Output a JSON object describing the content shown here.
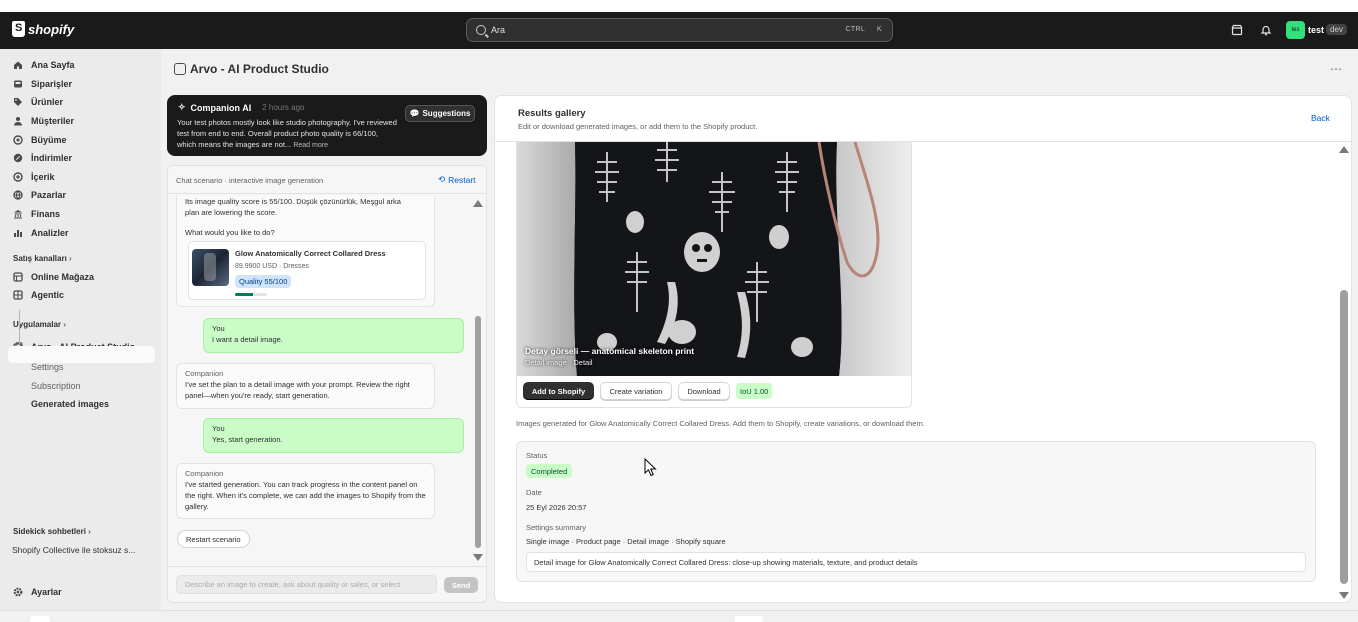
{
  "topbar": {
    "logo_text": "shopify",
    "search_placeholder": "Ara",
    "shortcut_ctrl": "CTRL",
    "shortcut_key": "K",
    "avatar_initials": "tes",
    "store_name": "test",
    "dev_badge": "dev",
    "accent_color": "#34e07a"
  },
  "sidebar": {
    "items": [
      {
        "label": "Ana Sayfa",
        "icon": "home-icon"
      },
      {
        "label": "Siparişler",
        "icon": "inbox-icon"
      },
      {
        "label": "Ürünler",
        "icon": "tag-icon"
      },
      {
        "label": "Müşteriler",
        "icon": "person-icon"
      },
      {
        "label": "Büyüme",
        "icon": "target-icon"
      },
      {
        "label": "İndirimler",
        "icon": "discount-icon"
      },
      {
        "label": "İçerik",
        "icon": "content-icon"
      },
      {
        "label": "Pazarlar",
        "icon": "globe-icon"
      },
      {
        "label": "Finans",
        "icon": "bank-icon"
      },
      {
        "label": "Analizler",
        "icon": "chart-icon"
      }
    ],
    "sales_channels_label": "Satış kanalları",
    "channels": [
      {
        "label": "Online Mağaza",
        "icon": "store-icon"
      },
      {
        "label": "Agentic",
        "icon": "grid-icon"
      }
    ],
    "apps_label": "Uygulamalar",
    "app_name": "Arvo - AI Product Studio",
    "app_subitems": [
      "Settings",
      "Subscription",
      "Generated images"
    ],
    "sidekick_label": "Sidekick sohbetleri",
    "sidekick_item": "Shopify Collective ile stoksuz s...",
    "settings_label": "Ayarlar"
  },
  "page": {
    "title": "Arvo - AI Product Studio",
    "more": "⋯"
  },
  "companion": {
    "title": "Companion AI",
    "time": "2 hours ago",
    "text": "Your test photos mostly look like studio photography. I've reviewed test from end to end. Overall product photo quality is 66/100, which means the images are not...",
    "read_more": "Read more",
    "suggestions": "Suggestions"
  },
  "chat": {
    "scenario_label": "Chat scenario · interactive image generation",
    "restart": "Restart",
    "first_bubble_line1": "Its image quality score is 55/100. Düşük çözünürlük, Meşgul arka",
    "first_bubble_line2": "plan are lowering the score.",
    "first_bubble_question": "What would you like to do?",
    "product": {
      "name": "Glow Anatomically Correct Collared Dress",
      "meta": "89.9900 USD · Dresses",
      "quality": "Quality 55/100",
      "quality_fraction": 0.55
    },
    "messages": [
      {
        "who": "You",
        "text": "I want a detail image."
      },
      {
        "who": "Companion",
        "text": "I've set the plan to a detail image with your prompt. Review the right panel—when you're ready, start generation."
      },
      {
        "who": "You",
        "text": "Yes, start generation."
      },
      {
        "who": "Companion",
        "text": "I've started generation. You can track progress in the content panel on the right. When it's complete, we can add the images to Shopify from the gallery."
      }
    ],
    "restart_scenario": "Restart scenario",
    "input_placeholder": "Describe an image to create, ask about quality or sales, or select",
    "send": "Send"
  },
  "results": {
    "title": "Results gallery",
    "subtitle": "Edit or download generated images, or add them to the Shopify product.",
    "back": "Back",
    "image_label": "Detay görseli — anatomical skeleton print",
    "image_sublabel": "Detail image · Detail",
    "add_to_shopify": "Add to Shopify",
    "create_variation": "Create variation",
    "download": "Download",
    "iou": "IoU 1.00",
    "note": "Images generated for Glow Anatomically Correct Collared Dress. Add them to Shopify, create variations, or download them.",
    "status_label": "Status",
    "status_value": "Completed",
    "date_label": "Date",
    "date_value": "25 Eyl 2026 20:57",
    "settings_label": "Settings summary",
    "settings_value": "Single image · Product page · Detail image · Shopify square",
    "prompt": "Detail image for Glow Anatomically Correct Collared Dress: close-up showing materials, texture, and product details"
  }
}
